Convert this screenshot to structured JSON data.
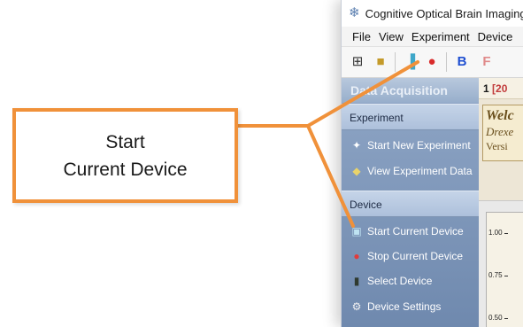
{
  "window": {
    "title": "Cognitive Optical Brain Imaging",
    "icon": "snowflake-app-icon"
  },
  "menu": [
    "File",
    "View",
    "Experiment",
    "Device"
  ],
  "toolbar": {
    "buttons": [
      {
        "icon": "grid-icon",
        "glyph": "⊞",
        "color": "#333333"
      },
      {
        "icon": "open-folder-icon",
        "glyph": "■",
        "color": "#c49a2a"
      },
      {
        "icon": "start-device-icon",
        "glyph": "▐",
        "color": "#3fa7c9"
      },
      {
        "icon": "stop-icon",
        "glyph": "●",
        "color": "#d92b2b"
      },
      {
        "icon": "bold-icon",
        "glyph": "B",
        "color": "#1f4fd1"
      },
      {
        "icon": "format-icon",
        "glyph": "F",
        "color": "#e08a8a"
      }
    ]
  },
  "sidepanel": {
    "header": "Data Acquisition",
    "groups": [
      {
        "label": "Experiment",
        "items": [
          {
            "label": "Start New Experiment",
            "icon": "new-experiment-icon",
            "glyph": "✦",
            "color": "#ffffff"
          },
          {
            "label": "View Experiment Data",
            "icon": "view-data-icon",
            "glyph": "◆",
            "color": "#e9d36a"
          }
        ]
      },
      {
        "label": "Device",
        "items": [
          {
            "label": "Start Current Device",
            "icon": "start-device-icon",
            "glyph": "▣",
            "color": "#bfe3f2"
          },
          {
            "label": "Stop Current Device",
            "icon": "stop-device-icon",
            "glyph": "●",
            "color": "#e13b3b"
          },
          {
            "label": "Select Device",
            "icon": "traffic-light-icon",
            "glyph": "▮",
            "color": "#2f3a2f"
          },
          {
            "label": "Device Settings",
            "icon": "gear-icon",
            "glyph": "⚙",
            "color": "#f2f2f2"
          }
        ]
      }
    ]
  },
  "content": {
    "tab_number": "1",
    "tab_date": "[20",
    "welcome_text": "Welc",
    "institution_text": "Drexe",
    "version_text": "Versi",
    "plot_ticks": [
      "1.00",
      "0.75",
      "0.50"
    ]
  },
  "callout": {
    "line1": "Start",
    "line2": "Current Device",
    "border_color": "#f0913a"
  }
}
